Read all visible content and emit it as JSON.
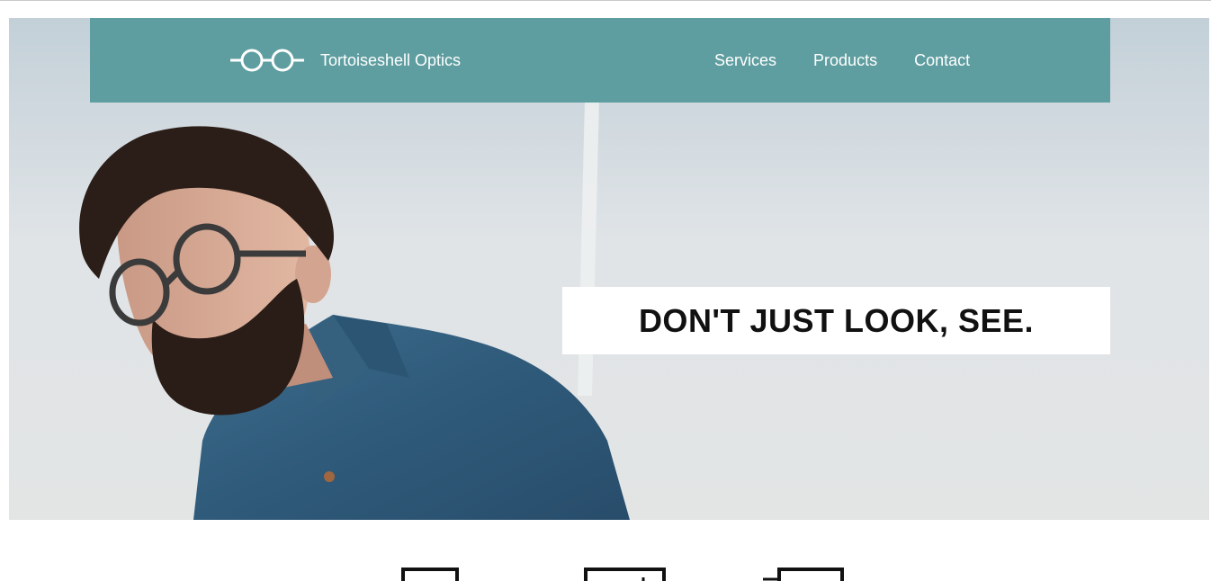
{
  "header": {
    "brand_name": "Tortoiseshell Optics",
    "logo_icon": "eyeglasses-icon",
    "background_color": "#5f9ea0",
    "nav": [
      {
        "label": "Services"
      },
      {
        "label": "Products"
      },
      {
        "label": "Contact"
      }
    ]
  },
  "hero": {
    "image_icon": "man-with-glasses-photo",
    "tagline": "DON'T JUST LOOK, SEE."
  },
  "features": {
    "icons": [
      "feature-icon-1",
      "feature-icon-2",
      "feature-icon-3"
    ]
  }
}
